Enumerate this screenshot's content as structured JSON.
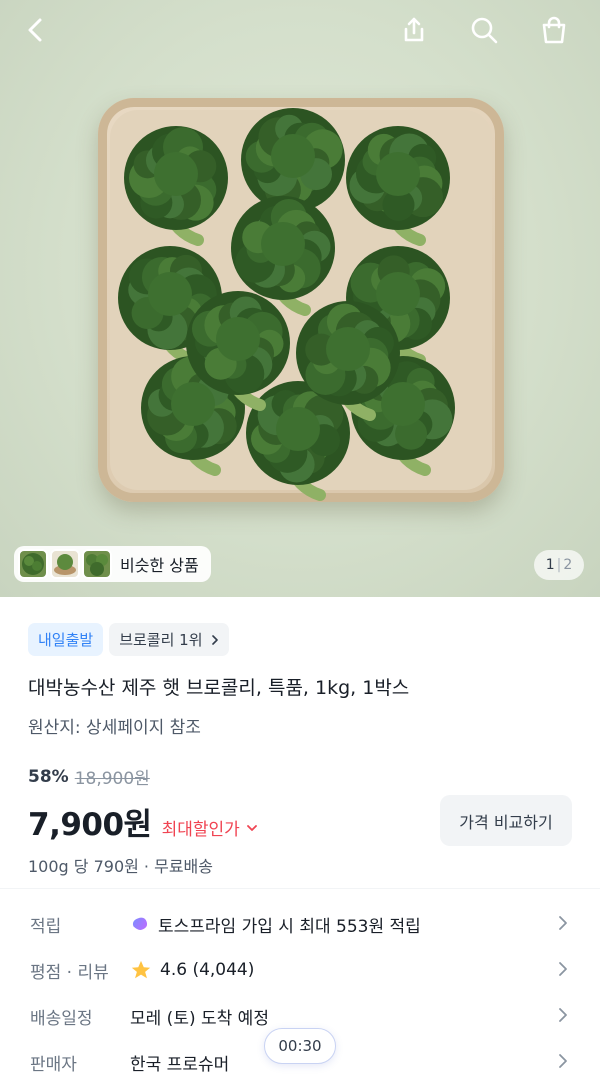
{
  "topbar": {
    "back_icon": "chevron-left-icon",
    "share_icon": "share-icon",
    "search_icon": "search-icon",
    "cart_icon": "shopping-bag-icon"
  },
  "gallery": {
    "similar_label": "비슷한 상품",
    "page_current": "1",
    "page_total": "2"
  },
  "product": {
    "badge_shipping": "내일출발",
    "badge_rank": "브로콜리 1위",
    "title": "대박농수산 제주 햇 브로콜리, 특품, 1kg, 1박스",
    "origin": "원산지: 상세페이지 참조",
    "discount": "58%",
    "original_price": "18,900원",
    "price": "7,900원",
    "max_discount_label": "최대할인가",
    "compare_button": "가격 비교하기",
    "unit_price": "100g 당 790원 · 무료배송"
  },
  "details": [
    {
      "label": "적립",
      "value": "토스프라임 가입 시 최대 553원 적립",
      "icon": "toss-prime-icon"
    },
    {
      "label": "평점 · 리뷰",
      "value": "4.6 (4,044)",
      "icon": "star-icon"
    },
    {
      "label": "배송일정",
      "value": "모레 (토) 도착 예정"
    },
    {
      "label": "판매자",
      "value": "한국 프로슈머"
    }
  ],
  "timer": "00:30",
  "colors": {
    "accent_blue": "#3182f6",
    "discount_red": "#f04452",
    "star": "#ffc342"
  }
}
